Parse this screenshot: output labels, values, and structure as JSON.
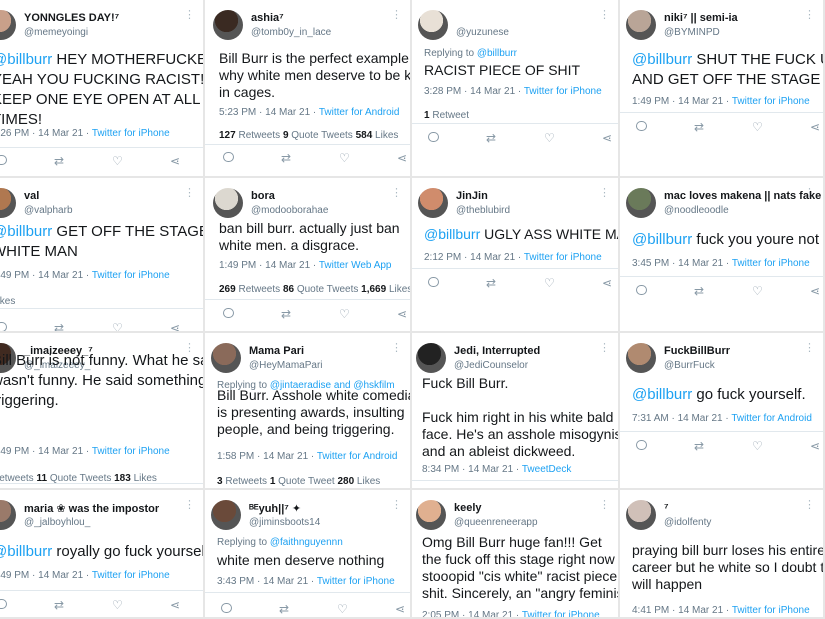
{
  "tweets": [
    {
      "name": "YONNGLES DAY!⁷",
      "handle": "@memeyoingi",
      "reply": "",
      "reply_to": "",
      "mention": "@billburr",
      "text": " HEY MOTHERFUCKER\nYEAH YOU FUCKING RACIST!\nKEEP ONE EYE OPEN AT ALL\nTIMES!",
      "time": "3:26 PM · 14 Mar 21 · ",
      "source": "Twitter for iPhone",
      "stats": ""
    },
    {
      "name": "ashia⁷",
      "handle": "@tomb0y_in_lace",
      "reply": "",
      "reply_to": "",
      "mention": "",
      "text": "Bill Burr is the perfect example of\nwhy white men deserve to be kept\nin  cages.",
      "time": "5:23 PM · 14 Mar 21 · ",
      "source": "Twitter for Android",
      "stats": {
        "a": "127",
        "a_label": " Retweets   ",
        "b": "9",
        "b_label": " Quote Tweets   ",
        "c": "584",
        "c_label": " Likes"
      }
    },
    {
      "name": "",
      "handle": "@yuzunese",
      "reply": "Replying to ",
      "reply_to": "@billburr",
      "mention": "",
      "text": "RACIST PIECE OF SHIT",
      "time": "3:28 PM · 14 Mar 21 · ",
      "source": "Twitter for iPhone",
      "stats": {
        "a": "1",
        "a_label": " Retweet",
        "b": "",
        "b_label": "",
        "c": "",
        "c_label": ""
      }
    },
    {
      "name": "niki⁷ || semi-ia",
      "handle": "@BYMINPD",
      "reply": "",
      "reply_to": "",
      "mention": "@billburr",
      "text": " SHUT THE FUCK UP\nAND GET OFF THE STAGE",
      "time": "1:49 PM · 14 Mar 21 · ",
      "source": "Twitter for iPhone",
      "stats": ""
    },
    {
      "name": "val",
      "handle": "@valpharb",
      "reply": "",
      "reply_to": "",
      "mention": "@billburr",
      "text": " GET OFF THE STAGE\nWHITE MAN",
      "time": "1:49 PM · 14 Mar 21 · ",
      "source": "Twitter for iPhone",
      "stats": {
        "a": "",
        "a_label": "Likes",
        "b": "",
        "b_label": "",
        "c": "",
        "c_label": ""
      }
    },
    {
      "name": "bora",
      "handle": "@modooborahae",
      "reply": "",
      "reply_to": "",
      "mention": "",
      "text": "ban bill burr. actually just ban\nwhite men. a disgrace.",
      "time": "1:49 PM · 14 Mar 21 · ",
      "source": "Twitter Web App",
      "stats": {
        "a": "269",
        "a_label": " Retweets   ",
        "b": "86",
        "b_label": " Quote Tweets   ",
        "c": "1,669",
        "c_label": " Likes"
      }
    },
    {
      "name": "JinJin",
      "handle": "@theblubird",
      "reply": "",
      "reply_to": "",
      "mention": "@billburr",
      "text": " UGLY ASS WHITE MAN",
      "time": "2:12 PM · 14 Mar 21 · ",
      "source": "Twitter for iPhone",
      "stats": ""
    },
    {
      "name": "mac loves makena || nats fake part",
      "handle": "@noodleoodle",
      "reply": "",
      "reply_to": "",
      "mention": "@billburr",
      "text": " fuck you youre not funny",
      "time": "3:45 PM · 14 Mar 21 · ",
      "source": "Twitter for iPhone",
      "stats": ""
    },
    {
      "name": "_imaizeeey_⁷",
      "handle": "@_imaizeeey_",
      "reply": "",
      "reply_to": "",
      "mention": "",
      "text": "Bill Burr is not funny. What he said\nwasn't funny. He said something\ntriggering.",
      "time": "1:49 PM · 14 Mar 21 · ",
      "source": "Twitter for iPhone",
      "stats": {
        "a": "",
        "a_label": "Retweets   ",
        "b": "11",
        "b_label": " Quote Tweets   ",
        "c": "183",
        "c_label": " Likes"
      }
    },
    {
      "name": "Mama Pari",
      "handle": "@HeyMamaPari",
      "reply": "Replying to ",
      "reply_to": "@jintaeradise and @hskfilm",
      "mention": "",
      "text": "Bill Burr. Asshole white comedian\nis presenting awards, insulting\npeople, and being triggering.",
      "time": "1:58 PM · 14 Mar 21 · ",
      "source": "Twitter for Android",
      "stats": {
        "a": "3",
        "a_label": " Retweets   ",
        "b": "1",
        "b_label": " Quote Tweet   ",
        "c": "280",
        "c_label": " Likes"
      }
    },
    {
      "name": "Jedi, Interrupted",
      "handle": "@JediCounselor",
      "reply": "",
      "reply_to": "",
      "mention": "",
      "text": "Fuck Bill Burr.\n\nFuck him right in his white bald\nface. He's an asshole misogynist\nand an ableist dickweed.",
      "time": "8:34 PM · 14 Mar 21 · ",
      "source": "TweetDeck",
      "stats": ""
    },
    {
      "name": "FuckBillBurr",
      "handle": "@BurrFuck",
      "reply": "",
      "reply_to": "",
      "mention": "@billburr",
      "text": " go fuck yourself.",
      "time": "7:31 AM · 14 Mar 21 · ",
      "source": "Twitter for Android",
      "stats": ""
    },
    {
      "name": "maria ❀ was the impostor",
      "handle": "@_jalboyhlou_",
      "reply": "",
      "reply_to": "",
      "mention": "@billburr",
      "text": " royally go fuck yourself",
      "time": "1:49 PM · 14 Mar 21 · ",
      "source": "Twitter for iPhone",
      "stats": ""
    },
    {
      "name": "ᴮᴱyuh||⁷ ✦",
      "handle": "@jiminsboots14",
      "reply": "Replying to ",
      "reply_to": "@faithnguyennn",
      "mention": "",
      "text": "white men deserve nothing",
      "time": "3:43 PM · 14 Mar 21 · ",
      "source": "Twitter for iPhone",
      "stats": ""
    },
    {
      "name": "keely",
      "handle": "@queenreneerapp",
      "reply": "",
      "reply_to": "",
      "mention": "",
      "text": "Omg Bill Burr huge fan!!! Get\nthe fuck off this stage right now u\nstooopid \"cis white\" racist piece of\nshit. Sincerely, an \"angry feminist\"",
      "time": "2:05 PM · 14 Mar 21 · ",
      "source": "Twitter for iPhone",
      "stats": ""
    },
    {
      "name": "⁷",
      "handle": "@idolfenty",
      "reply": "",
      "reply_to": "",
      "mention": "",
      "text": "praying bill burr loses his entire\ncareer but he white so I doubt that\nwill happen",
      "time": "4:41 PM · 14 Mar 21 · ",
      "source": "Twitter for iPhone",
      "stats": ""
    }
  ],
  "colors": {
    "link": "#1da1f2",
    "muted": "#657786",
    "border": "#e6e6e6"
  },
  "icons": [
    "reply-icon",
    "retweet-icon",
    "like-icon",
    "share-icon",
    "more-icon"
  ]
}
